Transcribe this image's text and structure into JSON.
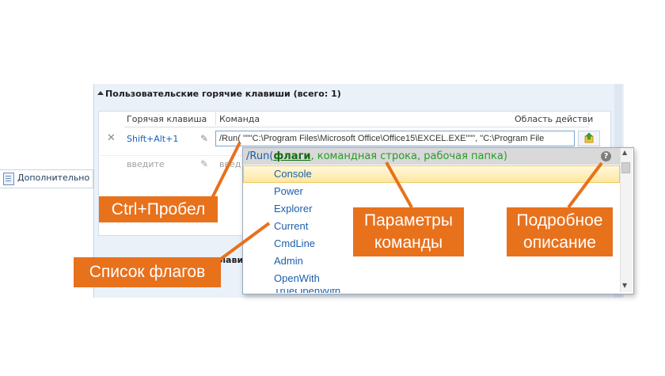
{
  "nav": {
    "label": "Дополнительно"
  },
  "section": {
    "title": "Пользовательские горячие клавиши (всего: 1)"
  },
  "table": {
    "headers": {
      "hotkey": "Горячая клавиша",
      "command": "Команда",
      "scope": "Область действи"
    },
    "rows": [
      {
        "hotkey": "Shift+Alt+1",
        "command": "/Run( \"\"\"C:\\Program Files\\Microsoft Office\\Office15\\EXCEL.EXE\"\"\", \"C:\\Program File"
      },
      {
        "hotkey": "введите",
        "command": "введ"
      }
    ],
    "hidden_fragment": "лавиши"
  },
  "popup": {
    "signature": {
      "fn": "/Run(",
      "current": "флаги",
      "rest": ", командная строка, рабочая папка)"
    },
    "help": "?",
    "flags": [
      "Console",
      "Power",
      "Explorer",
      "Current",
      "CmdLine",
      "Admin",
      "OpenWith",
      "TrueOpenWith"
    ],
    "selected_index": 0
  },
  "callouts": {
    "ctrl": "Ctrl+Пробел",
    "list": "Список флагов",
    "params": [
      "Параметры",
      "команды"
    ],
    "desc": [
      "Подробное",
      "описание"
    ]
  },
  "colors": {
    "callout": "#e8711c",
    "link": "#1c5faa",
    "signature": "#2a9a2a"
  },
  "icons": {
    "delete": "close-icon",
    "edit": "pencil-icon",
    "run": "run-icon",
    "help": "help-icon",
    "nav": "page-icon"
  }
}
